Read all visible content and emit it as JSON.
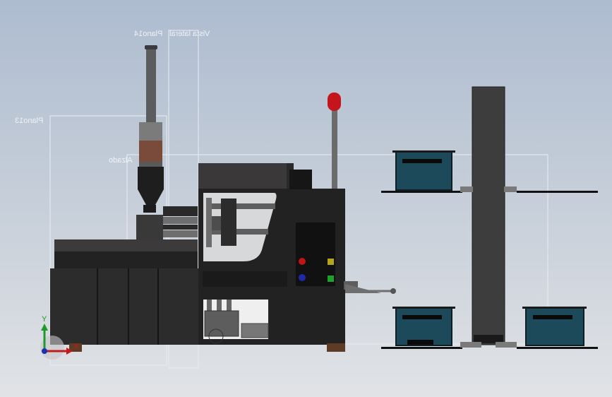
{
  "planes": {
    "lateral": "Vista lateral",
    "plano14": "Plano14",
    "plano13": "Plano13",
    "alzado": "Alzado"
  },
  "triad": {
    "x_label": "X",
    "y_label": "Y"
  },
  "colors": {
    "background_top": "#aebcd0",
    "background_bottom": "#e1e3e6",
    "machine_dark": "#2b2a2a",
    "conveyor_bins": "#1d4a5a",
    "beacon_red": "#c3151b",
    "panel_red": "#c21414",
    "panel_blue": "#1e2aa8",
    "panel_yellow": "#b5a51a",
    "panel_green": "#1ea12c"
  }
}
